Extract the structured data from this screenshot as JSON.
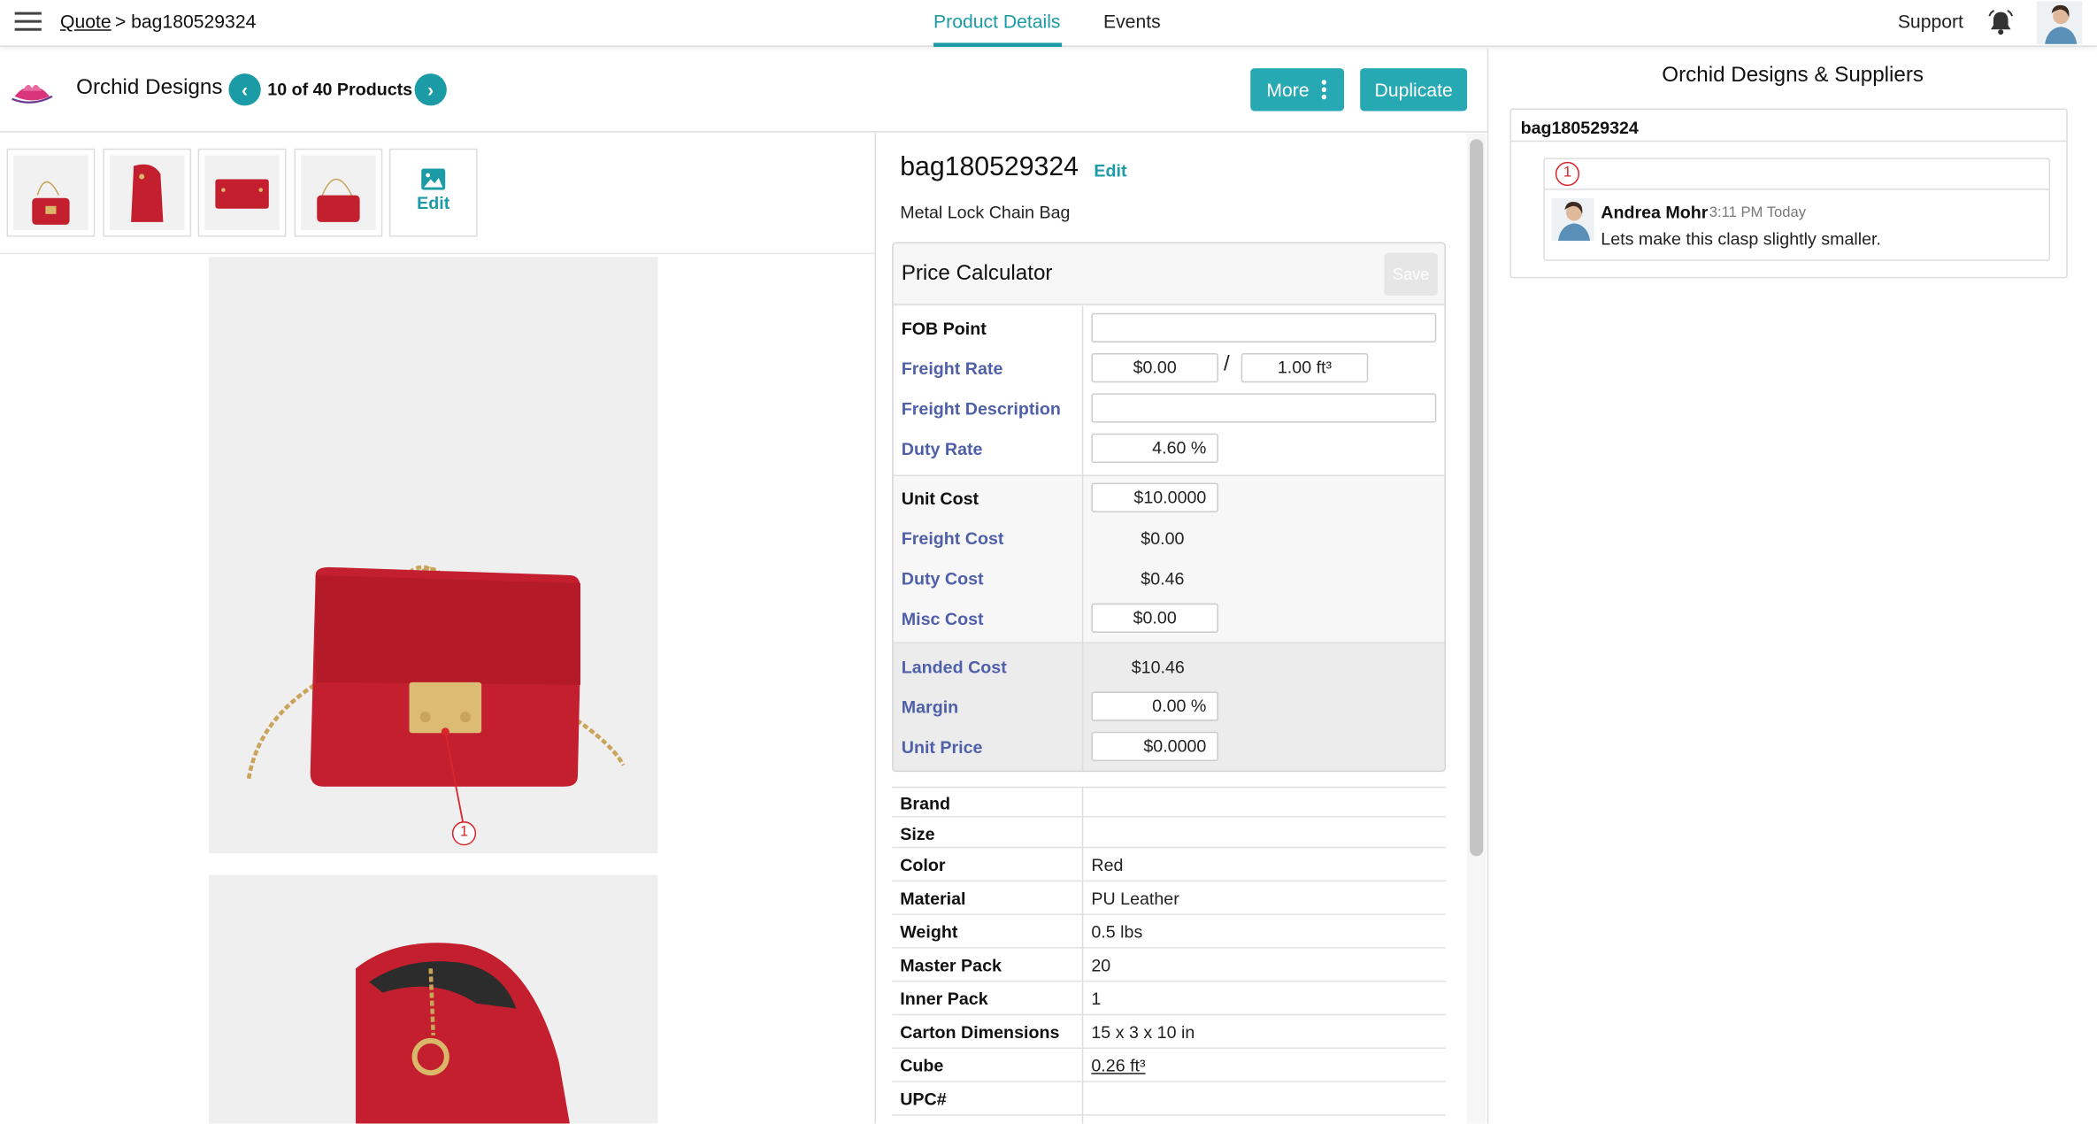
{
  "header": {
    "breadcrumb_root": "Quote",
    "breadcrumb_sep": ">",
    "breadcrumb_current": "bag180529324",
    "tabs": [
      {
        "label": "Product Details",
        "active": true
      },
      {
        "label": "Events",
        "active": false
      }
    ],
    "support_label": "Support"
  },
  "subheader": {
    "company": "Orchid Designs",
    "product_counter": "10 of 40 Products",
    "prev_icon": "chevron-left-icon",
    "next_icon": "chevron-right-icon",
    "more_label": "More",
    "duplicate_label": "Duplicate"
  },
  "gallery": {
    "edit_label": "Edit",
    "annotation_number": "1"
  },
  "product": {
    "sku": "bag180529324",
    "edit_label": "Edit",
    "description": "Metal Lock Chain Bag"
  },
  "price_calculator": {
    "title": "Price Calculator",
    "save_label": "Save",
    "fob_point_label": "FOB Point",
    "fob_point_value": "",
    "freight_rate_label": "Freight Rate",
    "freight_rate_value": "$0.00",
    "freight_rate_sep": "/",
    "freight_rate_per": "1.00 ft³",
    "freight_description_label": "Freight Description",
    "freight_description_value": "",
    "duty_rate_label": "Duty Rate",
    "duty_rate_value": "4.60 %",
    "unit_cost_label": "Unit Cost",
    "unit_cost_value": "$10.0000",
    "freight_cost_label": "Freight Cost",
    "freight_cost_value": "$0.00",
    "duty_cost_label": "Duty Cost",
    "duty_cost_value": "$0.46",
    "misc_cost_label": "Misc Cost",
    "misc_cost_value": "$0.00",
    "landed_cost_label": "Landed Cost",
    "landed_cost_value": "$10.46",
    "margin_label": "Margin",
    "margin_value": "0.00 %",
    "unit_price_label": "Unit Price",
    "unit_price_value": "$0.0000"
  },
  "attributes": [
    {
      "key": "Brand",
      "value": ""
    },
    {
      "key": "Size",
      "value": ""
    },
    {
      "key": "Color",
      "value": "Red"
    },
    {
      "key": "Material",
      "value": "PU Leather"
    },
    {
      "key": "Weight",
      "value": "0.5 lbs"
    },
    {
      "key": "Master Pack",
      "value": "20"
    },
    {
      "key": "Inner Pack",
      "value": "1"
    },
    {
      "key": "Carton Dimensions",
      "value": "15 x 3 x 10 in"
    },
    {
      "key": "Cube",
      "value": "0.26 ft³"
    },
    {
      "key": "UPC#",
      "value": ""
    }
  ],
  "right_panel": {
    "title": "Orchid Designs & Suppliers",
    "thread_title": "bag180529324",
    "badge": "1",
    "comment_author": "Andrea Mohr",
    "comment_time": "3:11 PM Today",
    "comment_text": "Lets make this clasp slightly smaller."
  },
  "colors": {
    "accent": "#1b9ba6",
    "label_blue": "#4f60a8",
    "badge_red": "#d9262c",
    "bag_red": "#c41f2e"
  }
}
